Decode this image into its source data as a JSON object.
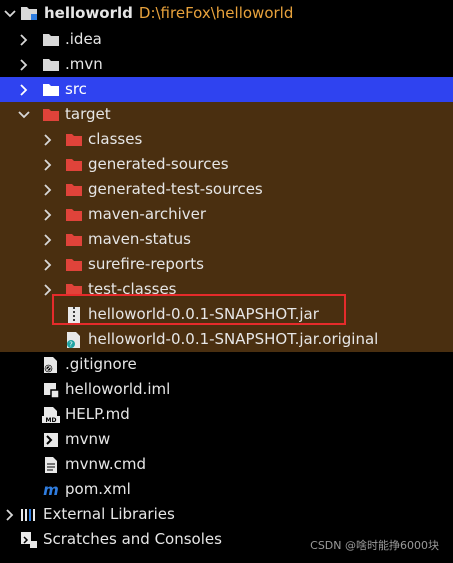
{
  "project": {
    "name": "helloworld",
    "path": "D:\\fireFox\\helloworld"
  },
  "tree": {
    "idea": ".idea",
    "mvn": ".mvn",
    "src": "src",
    "target": "target",
    "classes": "classes",
    "generated_sources": "generated-sources",
    "generated_test_sources": "generated-test-sources",
    "maven_archiver": "maven-archiver",
    "maven_status": "maven-status",
    "surefire_reports": "surefire-reports",
    "test_classes": "test-classes",
    "jar": "helloworld-0.0.1-SNAPSHOT.jar",
    "jar_original": "helloworld-0.0.1-SNAPSHOT.jar.original",
    "gitignore": ".gitignore",
    "iml": "helloworld.iml",
    "help": "HELP.md",
    "mvnw": "mvnw",
    "mvnw_cmd": "mvnw.cmd",
    "pom": "pom.xml",
    "external_libraries": "External Libraries",
    "scratches": "Scratches and Consoles"
  },
  "watermark": "CSDN @啥时能挣6000块",
  "colors": {
    "selection": "#2f43f0",
    "target_bg": "#4a2f10",
    "folder_grey": "#d8d8d8",
    "folder_red": "#e0433a",
    "path_orange": "#e8a23c",
    "highlight": "#e52b2b"
  },
  "icons": {
    "collapsed": "chevron-right-icon",
    "expanded": "chevron-down-icon",
    "folder": "folder-icon",
    "jar": "jar-icon",
    "file": "file-icon",
    "markdown": "markdown-icon",
    "terminal": "terminal-icon",
    "maven": "maven-icon",
    "libraries": "libraries-icon",
    "scratches": "scratches-icon"
  }
}
